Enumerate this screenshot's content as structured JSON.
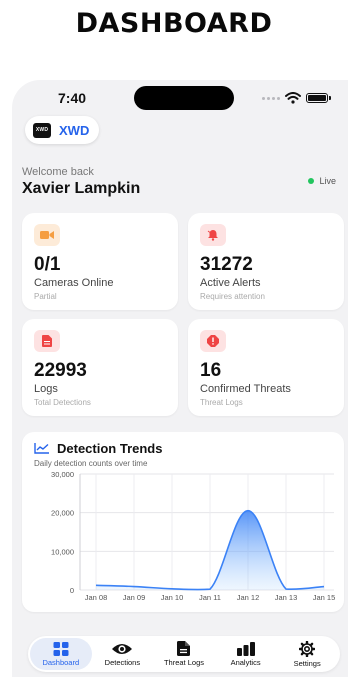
{
  "banner": {
    "title": "DASHBOARD"
  },
  "status": {
    "time": "7:40"
  },
  "brand": {
    "logo_text": "XWD",
    "name": "XWD",
    "color": "#2563eb"
  },
  "welcome": {
    "greeting": "Welcome back",
    "user_name": "Xavier Lampkin",
    "live_label": "Live"
  },
  "stats": [
    {
      "value": "0/1",
      "label": "Cameras Online",
      "sub": "Partial",
      "icon": "video-camera-icon",
      "icon_bg": "#fdebd8",
      "icon_color": "#f59e42"
    },
    {
      "value": "31272",
      "label": "Active Alerts",
      "sub": "Requires attention",
      "icon": "bell-icon",
      "icon_bg": "#fde2e2",
      "icon_color": "#ef4444"
    },
    {
      "value": "22993",
      "label": "Logs",
      "sub": "Total Detections",
      "icon": "document-icon",
      "icon_bg": "#fde2e2",
      "icon_color": "#ef4444"
    },
    {
      "value": "16",
      "label": "Confirmed Threats",
      "sub": "Threat Logs",
      "icon": "alert-icon",
      "icon_bg": "#fde2e2",
      "icon_color": "#ef4444"
    }
  ],
  "chart": {
    "title": "Detection Trends",
    "subtitle": "Daily detection counts over time"
  },
  "chart_data": {
    "type": "area",
    "title": "Detection Trends",
    "categories": [
      "Jan 08",
      "Jan 09",
      "Jan 10",
      "Jan 11",
      "Jan 12",
      "Jan 13",
      "Jan 15"
    ],
    "values": [
      1200,
      900,
      300,
      200,
      20500,
      250,
      900
    ],
    "ylim": [
      0,
      30000
    ],
    "yticks": [
      0,
      10000,
      20000,
      30000
    ],
    "ytick_labels": [
      "0",
      "10,000",
      "20,000",
      "30,000"
    ],
    "grid": true,
    "color": "#3b82f6"
  },
  "tabs": [
    {
      "label": "Dashboard",
      "icon": "grid-icon",
      "active": true
    },
    {
      "label": "Detections",
      "icon": "eye-icon",
      "active": false
    },
    {
      "label": "Threat Logs",
      "icon": "file-icon",
      "active": false
    },
    {
      "label": "Analytics",
      "icon": "bar-chart-icon",
      "active": false
    },
    {
      "label": "Settings",
      "icon": "gear-icon",
      "active": false
    }
  ]
}
